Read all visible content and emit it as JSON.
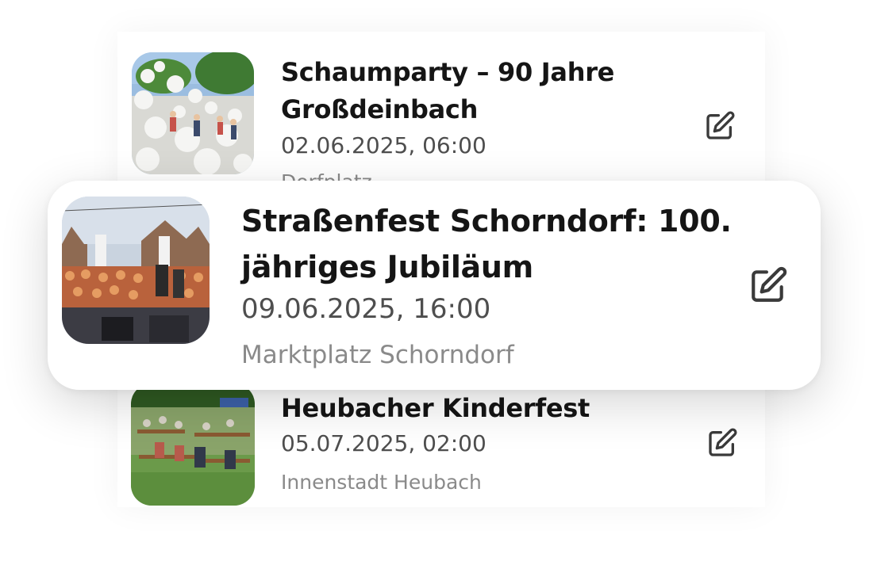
{
  "events": [
    {
      "title": "Schaumparty – 90 Jahre Großdeinbach",
      "datetime": "02.06.2025, 06:00",
      "location": "Dorfplatz",
      "thumbnail": "foam-party-photo",
      "action_icon": "edit-icon"
    },
    {
      "title": "Straßenfest Schorndorf: 100. jähriges Jubiläum",
      "datetime": "09.06.2025, 16:00",
      "location": "Marktplatz Schorndorf",
      "thumbnail": "street-festival-crowd-photo",
      "action_icon": "edit-icon",
      "highlighted": true
    },
    {
      "title": "Heubacher Kinderfest",
      "datetime": "05.07.2025, 02:00",
      "location": "Innenstadt Heubach",
      "thumbnail": "beer-garden-festival-photo",
      "action_icon": "edit-icon"
    }
  ],
  "colors": {
    "title": "#151515",
    "date": "#4e4e4e",
    "location": "#8a8a8a",
    "icon": "#3a3a3a",
    "card_background": "#ffffff"
  }
}
